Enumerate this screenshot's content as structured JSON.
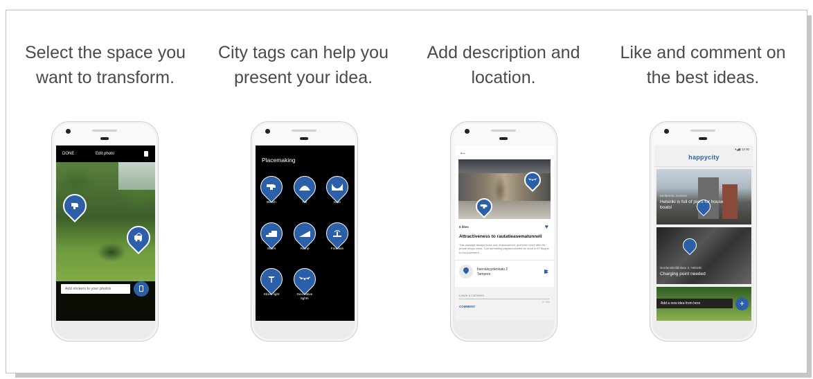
{
  "captions": [
    "Select the space you\nwant to transform.",
    "City tags can help you\npresent your idea.",
    "Add description and\nlocation.",
    "Like and comment on\nthe best ideas."
  ],
  "phone1": {
    "done": "DONE",
    "edit_photo": "Edit photo",
    "sticker_placeholder": "Add stickers to your photos"
  },
  "phone2": {
    "title": "Placemaking",
    "items": [
      "Bench",
      "Hill",
      "Dale",
      "Stairs",
      "Ramp",
      "Fountain",
      "Street light",
      "Decorative\nlights"
    ]
  },
  "phone3": {
    "likes": "6 likes",
    "title": "Attractiveness to rautatieasematunneli",
    "description": "This passage always looks sort of abandoned, and even more after its phone shops close. Can something playful/colourful be done to it? Maybe to the pavement...",
    "address_line1": "Itsenäisyydenkatu 2",
    "address_line2": "Tampere",
    "leave_comment": "Leave a comment",
    "counter": "0 / 300",
    "comment_button": "COMMENT"
  },
  "phone4": {
    "status_time": "12:30",
    "brand": "happycity",
    "card1_sub": "Eteläranta, Helsinki",
    "card1_title": "Helsinki is full of piers for house boats!",
    "card2_sub": "Nordenskiöldinkatu 3, Helsinki",
    "card2_title": "Charging point needed",
    "add_idea": "Add a new idea from here",
    "fab": "+"
  },
  "colors": {
    "accent": "#2b5fa8",
    "caption_text": "#4a4a4a"
  }
}
